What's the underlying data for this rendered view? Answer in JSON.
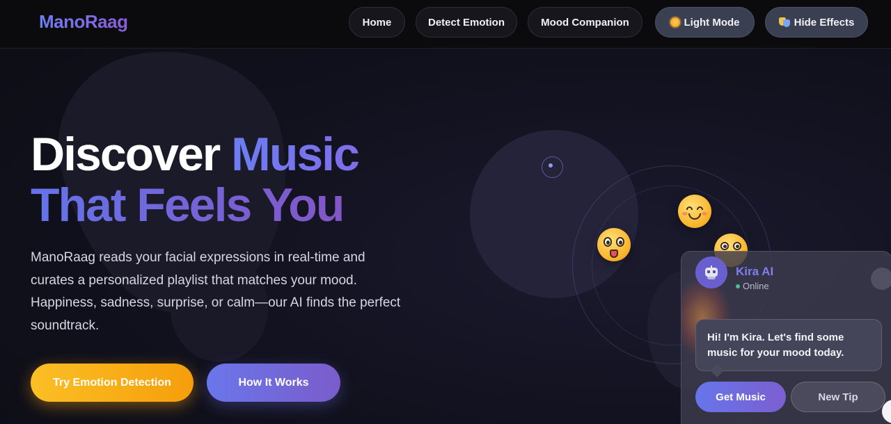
{
  "brand": {
    "logo": "ManoRaag"
  },
  "nav": {
    "items": [
      {
        "label": "Home"
      },
      {
        "label": "Detect Emotion"
      },
      {
        "label": "Mood Companion"
      }
    ],
    "light_mode": {
      "label": "Light Mode",
      "icon": "sun-icon"
    },
    "hide_effects": {
      "label": "Hide Effects",
      "icon": "theater-masks-icon"
    }
  },
  "hero": {
    "title_line1_white": "Discover ",
    "title_line1_accent": "Music",
    "title_line2": "That Feels You",
    "description": "ManoRaag reads your facial expressions in real-time and curates a personalized playlist that matches your mood. Happiness, sadness, surprise, or calm—our AI finds the perfect soundtrack.",
    "cta_primary": "Try Emotion Detection",
    "cta_secondary": "How It Works"
  },
  "decor": {
    "emojis": [
      "smiling-face-icon",
      "face-with-tongue-icon",
      "flushed-face-icon"
    ]
  },
  "chat": {
    "name": "Kira AI",
    "status": "Online",
    "message": "Hi! I'm Kira. Let's find some music for your mood today.",
    "buttons": {
      "get_music": "Get Music",
      "new_tip": "New Tip"
    }
  },
  "colors": {
    "accent_blue": "#6c7df2",
    "accent_purple": "#8256c6",
    "cta_yellow": "#fbbf24",
    "background": "#121220"
  }
}
